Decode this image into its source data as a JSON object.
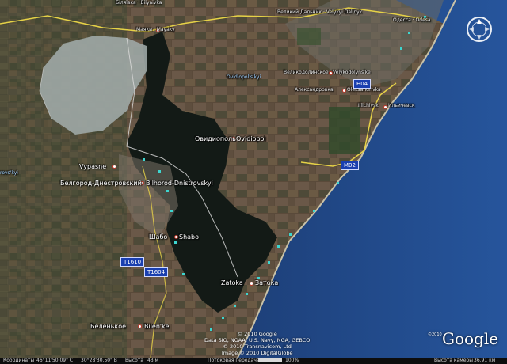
{
  "map": {
    "places": [
      {
        "id": "vypasne",
        "text": "Vypasne"
      },
      {
        "id": "bilhorod-ru",
        "text": "Белгород-Днестровский"
      },
      {
        "id": "bilhorod-en",
        "text": "Bilhorod-Dnistrovskyi"
      },
      {
        "id": "ovidiopol-ru",
        "text": "Овидиополь"
      },
      {
        "id": "ovidiopol-en",
        "text": "Ovidiopol"
      },
      {
        "id": "shabo-ru",
        "text": "Шабо"
      },
      {
        "id": "shabo-en",
        "text": "Shabo"
      },
      {
        "id": "zatoka-en",
        "text": "Zatoka"
      },
      {
        "id": "zatoka-ru",
        "text": "Затока"
      },
      {
        "id": "bilenke-ru",
        "text": "Беленькое"
      },
      {
        "id": "bilenke-en",
        "text": "Bilen'ke"
      },
      {
        "id": "illichivsk-en",
        "text": "Illichivsk"
      },
      {
        "id": "illichivsk-ru",
        "text": "Ильичевск"
      },
      {
        "id": "oleksandrivka-ru",
        "text": "Александровка"
      },
      {
        "id": "oleksandrivka-en",
        "text": "Oleksandrivka"
      },
      {
        "id": "velykodolynske-ru",
        "text": "Великодолинское"
      },
      {
        "id": "velykodolynske-en",
        "text": "Velykodolyns'ke"
      },
      {
        "id": "mayaky",
        "text": "Маяки · Mayaky"
      },
      {
        "id": "ovidiopol-region",
        "text": "Ovidiopol's'kyi"
      },
      {
        "id": "odesa",
        "text": "Одесса · Odesa"
      },
      {
        "id": "velykyi-dalnyk",
        "text": "Великий Дальник · Velykyi Dal'nyk"
      },
      {
        "id": "bilyaivka",
        "text": "Біляївка · Bilyaivka"
      },
      {
        "id": "rovskyi",
        "text": "rovs'kyi"
      }
    ],
    "road_shields": [
      {
        "id": "t1610",
        "text": "T1610"
      },
      {
        "id": "t1604",
        "text": "T1604"
      },
      {
        "id": "h04",
        "text": "H04"
      },
      {
        "id": "m02",
        "text": "M02"
      }
    ],
    "credits": [
      "© 2010 Google",
      "Data SIO, NOAA, U.S. Navy, NGA, GEBCO",
      "© 2010 Transnavicom, Ltd",
      "Image © 2010 DigitalGlobe"
    ],
    "logo": {
      "text": "Google",
      "copyright": "©2010"
    },
    "colors": {
      "water": "#131a16",
      "sea": "#1f4a8c",
      "border": "#d8d8d8",
      "road": "#e6d247"
    }
  },
  "status_bar": {
    "coordinates_label": "Координаты",
    "coordinates_value": "46°11'50.09\" С",
    "longitude_value": "30°28'30.50\" В",
    "elevation_label": "Высота",
    "elevation_value": "43 м",
    "streaming_label": "Потоковая передача",
    "streaming_value": "100%",
    "eye_alt_label": "Высота камеры",
    "eye_alt_value": "36.91 км"
  }
}
